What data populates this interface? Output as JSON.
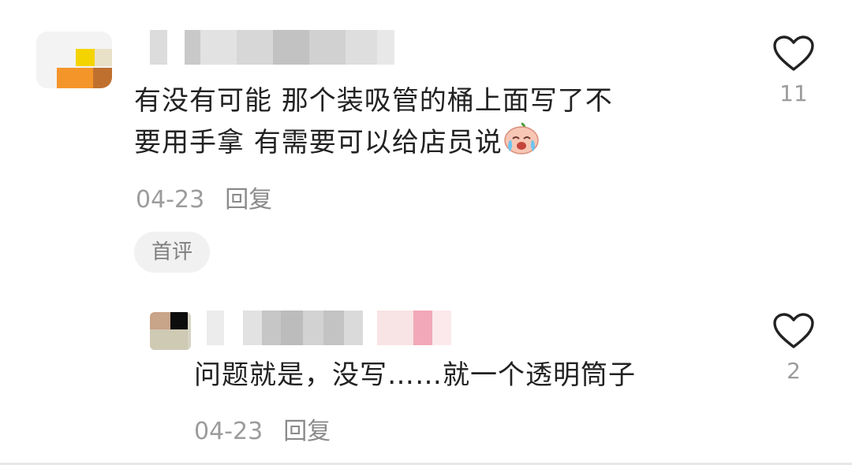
{
  "comment": {
    "text_line1": "有没有可能 那个装吸管的桶上面写了不",
    "text_line2": "要用手拿 有需要可以给店员说",
    "emoji": "crying-face-emoji",
    "date": "04-23",
    "reply_label": "回复",
    "like_count": "11",
    "badge": "首评"
  },
  "reply": {
    "text": "问题就是，没写……就一个透明筒子",
    "date": "04-23",
    "reply_label": "回复",
    "like_count": "2"
  },
  "colors": {
    "text": "#222222",
    "meta": "#9c9c9c",
    "badge_bg": "#f1f1f1"
  }
}
